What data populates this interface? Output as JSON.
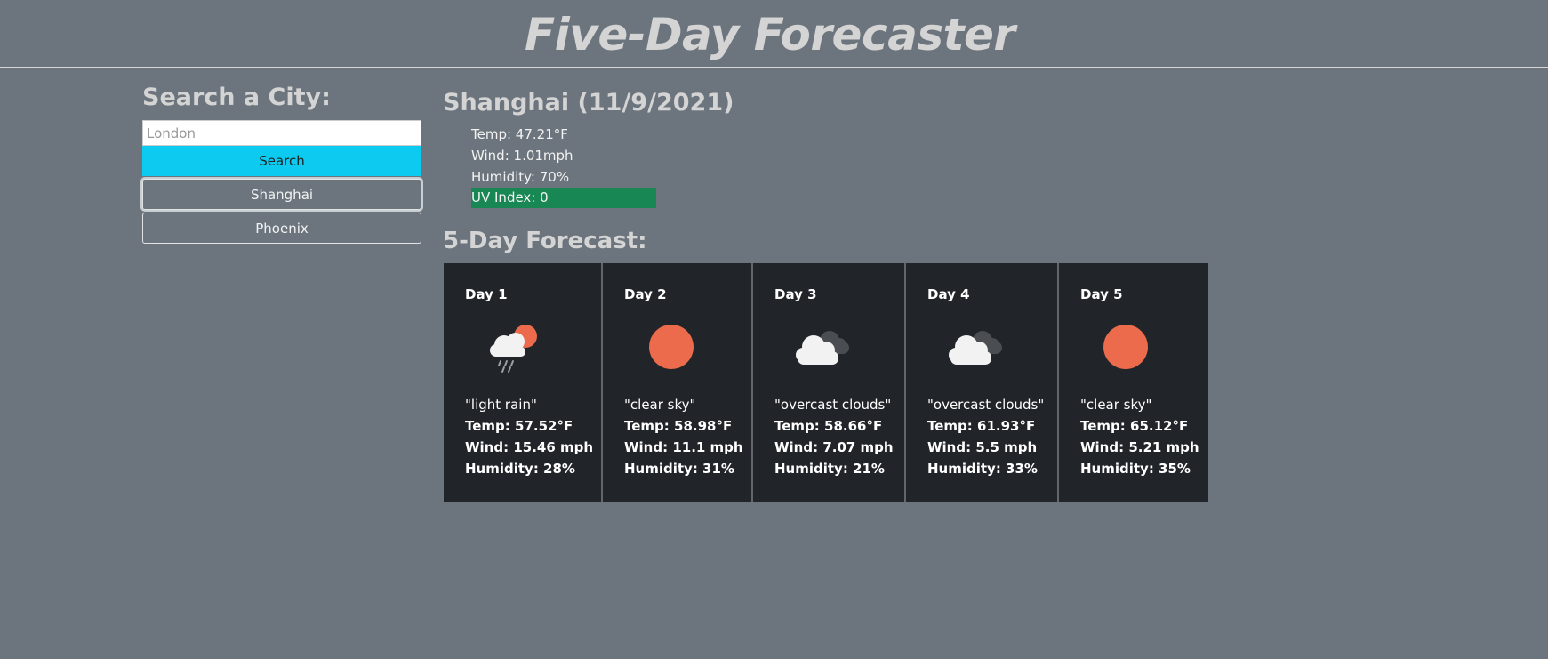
{
  "app": {
    "title": "Five-Day Forecaster"
  },
  "search": {
    "heading": "Search a City:",
    "placeholder": "London",
    "button_label": "Search",
    "history": [
      "Shanghai",
      "Phoenix"
    ]
  },
  "current": {
    "title": "Shanghai (11/9/2021)",
    "temp": "Temp: 47.21°F",
    "wind": "Wind: 1.01mph",
    "humidity": "Humidity: 70%",
    "uv": "UV Index: 0",
    "uv_color": "#198754"
  },
  "forecast": {
    "heading": "5-Day Forecast:",
    "days": [
      {
        "day": "Day 1",
        "icon": "light-rain-icon",
        "desc": "\"light rain\"",
        "temp": "Temp: 57.52°F",
        "wind": "Wind: 15.46 mph",
        "humidity": "Humidity: 28%"
      },
      {
        "day": "Day 2",
        "icon": "clear-sky-icon",
        "desc": "\"clear sky\"",
        "temp": "Temp: 58.98°F",
        "wind": "Wind: 11.1 mph",
        "humidity": "Humidity: 31%"
      },
      {
        "day": "Day 3",
        "icon": "overcast-clouds-icon",
        "desc": "\"overcast clouds\"",
        "temp": "Temp: 58.66°F",
        "wind": "Wind: 7.07 mph",
        "humidity": "Humidity: 21%"
      },
      {
        "day": "Day 4",
        "icon": "overcast-clouds-icon",
        "desc": "\"overcast clouds\"",
        "temp": "Temp: 61.93°F",
        "wind": "Wind: 5.5 mph",
        "humidity": "Humidity: 33%"
      },
      {
        "day": "Day 5",
        "icon": "clear-sky-icon",
        "desc": "\"clear sky\"",
        "temp": "Temp: 65.12°F",
        "wind": "Wind: 5.21 mph",
        "humidity": "Humidity: 35%"
      }
    ]
  },
  "colors": {
    "page_bg": "#6c757d",
    "card_bg": "#212529",
    "search_button": "#0dcaf0",
    "sun": "#ec6b4c"
  }
}
